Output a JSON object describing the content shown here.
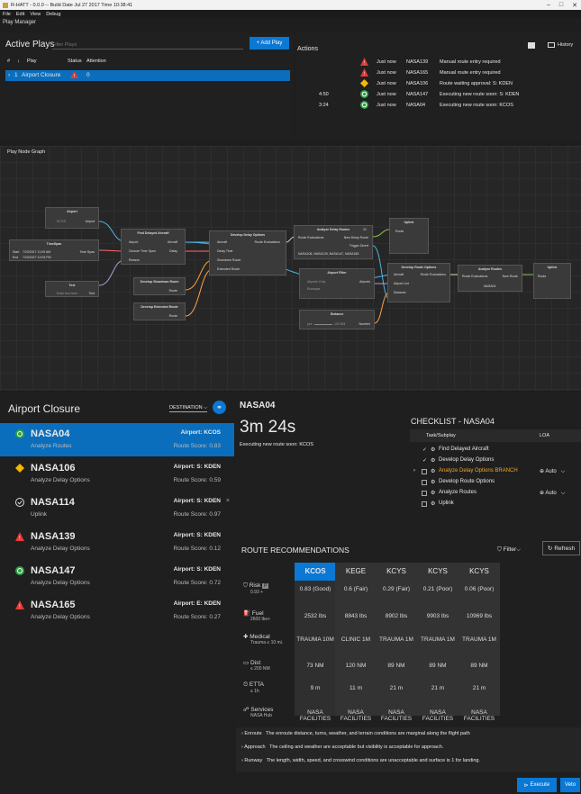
{
  "window": {
    "title": "R-HATT - 0.0.0 -- Build Date Jul 27 2017 Time 10:38:41",
    "controls": [
      "–",
      "□",
      "✕"
    ]
  },
  "menu": [
    "File",
    "Edit",
    "View",
    "Debug"
  ],
  "play_manager": "Play Manager",
  "active_plays": {
    "title": "Active Plays",
    "filter_placeholder": "Filter Plays",
    "add_label": "+ Add Play",
    "headers": {
      "num": "#",
      "sort": "↓",
      "play": "Play",
      "status": "Status",
      "attention": "Attention"
    },
    "rows": [
      {
        "num": "1",
        "name": "Airport Closure",
        "attention": "0"
      }
    ]
  },
  "actions": {
    "title": "Actions",
    "history_label": "History",
    "rows": [
      {
        "time": "",
        "status": "warn-red",
        "when": "Just now",
        "flight": "NASA139",
        "desc": "Manual route entry required"
      },
      {
        "time": "",
        "status": "warn-red",
        "when": "Just now",
        "flight": "NASA165",
        "desc": "Manual route entry required"
      },
      {
        "time": "",
        "status": "diamond-yellow",
        "when": "Just now",
        "flight": "NASA106",
        "desc": "Route waiting approval: S: KDEN"
      },
      {
        "time": "4:50",
        "status": "ok-green",
        "when": "Just now",
        "flight": "NASA147",
        "desc": "Executing new route soon: S: KDEN"
      },
      {
        "time": "3:24",
        "status": "ok-green",
        "when": "Just now",
        "flight": "NASA04",
        "desc": "Executing new route soon: KCOS"
      }
    ]
  },
  "graph": {
    "title": "Play Node Graph",
    "nodes": {
      "airport": {
        "title": "Airport",
        "l1": "KCOS",
        "p1": "Airport"
      },
      "timespan": {
        "title": "TimeSpan",
        "start_l": "Start",
        "start": "7/20/2017 11:09 AM",
        "end_l": "End",
        "end": "7/20/2017 12:09 PM",
        "out": "Time Span"
      },
      "text": {
        "title": "Text",
        "placeholder": "Enter text here",
        "out": "Text"
      },
      "find": {
        "title": "Find Delayed Aircraft",
        "i1": "Airport",
        "i2": "Closure Time Span",
        "i3": "Reason",
        "o1": "Aircraft",
        "o2": "Delay"
      },
      "slow": {
        "title": "Develop Slowdown Route",
        "o1": "Route"
      },
      "ext": {
        "title": "Develop Extended Route",
        "o1": "Route"
      },
      "delay": {
        "title": "Develop Delay Options",
        "i1": "Aircraft",
        "i2": "Delay Time",
        "i3": "Slowdown Route",
        "i4": "Extended Route",
        "o1": "Route Evaluations"
      },
      "analyze": {
        "title": "Analyze Delay Routes",
        "badge": "21",
        "i1": "Route Evaluations",
        "o1": "New Delay Route",
        "o2": "Trigger Divert",
        "list": "NASA106, NASA139, NASA147, NASA165"
      },
      "uplink1": {
        "title": "Uplink",
        "i1": "Route"
      },
      "filter": {
        "title": "Airport Filter",
        "l1": "Airports Only",
        "l2": "Runways",
        "out": "Airports"
      },
      "distance": {
        "title": "Distance",
        "lo": "yes",
        "hi": "100 NM",
        "out": "Number"
      },
      "route": {
        "title": "Develop Route Options",
        "i1": "Aircraft",
        "i2": "Airport List",
        "i3": "Distance",
        "o1": "Route Evaluations"
      },
      "aroutes": {
        "title": "Analyze Routes",
        "i1": "Route Evaluations",
        "o1": "New Route",
        "val": "NASA04"
      },
      "uplink2": {
        "title": "Uplink",
        "i1": "Route"
      }
    }
  },
  "closure": {
    "title": "Airport Closure",
    "destination": "DESTINATION",
    "items": [
      {
        "name": "NASA04",
        "sub": "Analyze Routes",
        "airport": "Airport: KCOS",
        "score": "Route Score: 0.83",
        "icon": "ok-green",
        "selected": true
      },
      {
        "name": "NASA106",
        "sub": "Analyze Delay Options",
        "airport": "Airport: S: KDEN",
        "score": "Route Score: 0.59",
        "icon": "diamond-yellow"
      },
      {
        "name": "NASA114",
        "sub": "Uplink",
        "airport": "Airport: S: KDEN",
        "score": "Route Score: 0.97",
        "icon": "check-circle",
        "close": "×"
      },
      {
        "name": "NASA139",
        "sub": "Analyze Delay Options",
        "airport": "Airport: S: KDEN",
        "score": "Route Score: 0.12",
        "icon": "warn-red"
      },
      {
        "name": "NASA147",
        "sub": "Analyze Delay Options",
        "airport": "Airport: S: KDEN",
        "score": "Route Score: 0.72",
        "icon": "ok-green"
      },
      {
        "name": "NASA165",
        "sub": "Analyze Delay Options",
        "airport": "Airport: E: KDEN",
        "score": "Route Score: 0.27",
        "icon": "warn-red"
      }
    ]
  },
  "detail": {
    "flight": "NASA04",
    "timer": "3m 24s",
    "status": "Executing new route soon: KCOS"
  },
  "checklist": {
    "title": "CHECKLIST - NASA04",
    "h_task": "Task/Subplay",
    "h_loa": "LOA",
    "items": [
      {
        "label": "Find Delayed Aircraft",
        "mark": "✓"
      },
      {
        "label": "Develop Delay Options",
        "mark": "✓"
      },
      {
        "label": "Analyze Delay Options BRANCH",
        "mark": "",
        "loa": "Auto",
        "hl": true
      },
      {
        "label": "Develop Route Options",
        "mark": ""
      },
      {
        "label": "Analyze Routes",
        "mark": "",
        "loa": "Auto"
      },
      {
        "label": "Uplink",
        "mark": ""
      }
    ]
  },
  "recs": {
    "title": "ROUTE RECOMMENDATIONS",
    "filter": "Filter",
    "refresh": "Refresh",
    "airports": [
      "KCOS",
      "KEGE",
      "KCYS",
      "KCYS",
      "KCYS"
    ],
    "metrics": [
      {
        "name": "Risk",
        "badge": "P",
        "sub": "0.93 +",
        "values": [
          "0.83 (Good)",
          "0.6 (Fair)",
          "0.29 (Fair)",
          "0.21 (Poor)",
          "0.06 (Poor)"
        ]
      },
      {
        "name": "Fuel",
        "sub": "2600 lbs+",
        "values": [
          "2532 lbs",
          "8843 lbs",
          "8902 lbs",
          "9903 lbs",
          "10969 lbs"
        ]
      },
      {
        "name": "Medical",
        "sub": "Trauma ≤ 10 mi.",
        "values": [
          "TRAUMA 10M",
          "CLINIC 1M",
          "TRAUMA 1M",
          "TRAUMA 1M",
          "TRAUMA 1M"
        ]
      },
      {
        "name": "Dist",
        "sub": "≤ 200 NM",
        "values": [
          "73 NM",
          "120 NM",
          "89 NM",
          "89 NM",
          "89 NM"
        ]
      },
      {
        "name": "ETTA",
        "sub": "≤ 1h",
        "values": [
          "9 m",
          "11 m",
          "21 m",
          "21 m",
          "21 m"
        ]
      },
      {
        "name": "Services",
        "sub": "NASA Hub",
        "values": [
          "NASA FACILITIES",
          "NASA FACILITIES",
          "NASA FACILITIES",
          "NASA FACILITIES",
          "NASA FACILITIES"
        ]
      }
    ],
    "notes": [
      {
        "k": "Enroute",
        "v": "The enroute distance, turns, weather, and terrain conditions are marginal along the flight path"
      },
      {
        "k": "Approach",
        "v": "The ceiling and weather are acceptable but visibility is acceptable for approach."
      },
      {
        "k": "Runway",
        "v": "The length, width, speed, and crosswind conditions are unacceptable and surface is 1 for landing."
      }
    ]
  },
  "buttons": {
    "execute": "Execute",
    "veto": "Veto"
  },
  "colors": {
    "accent": "#0a78d4",
    "red": "#e53935",
    "yellow": "#f5b800",
    "green": "#2ea043"
  }
}
